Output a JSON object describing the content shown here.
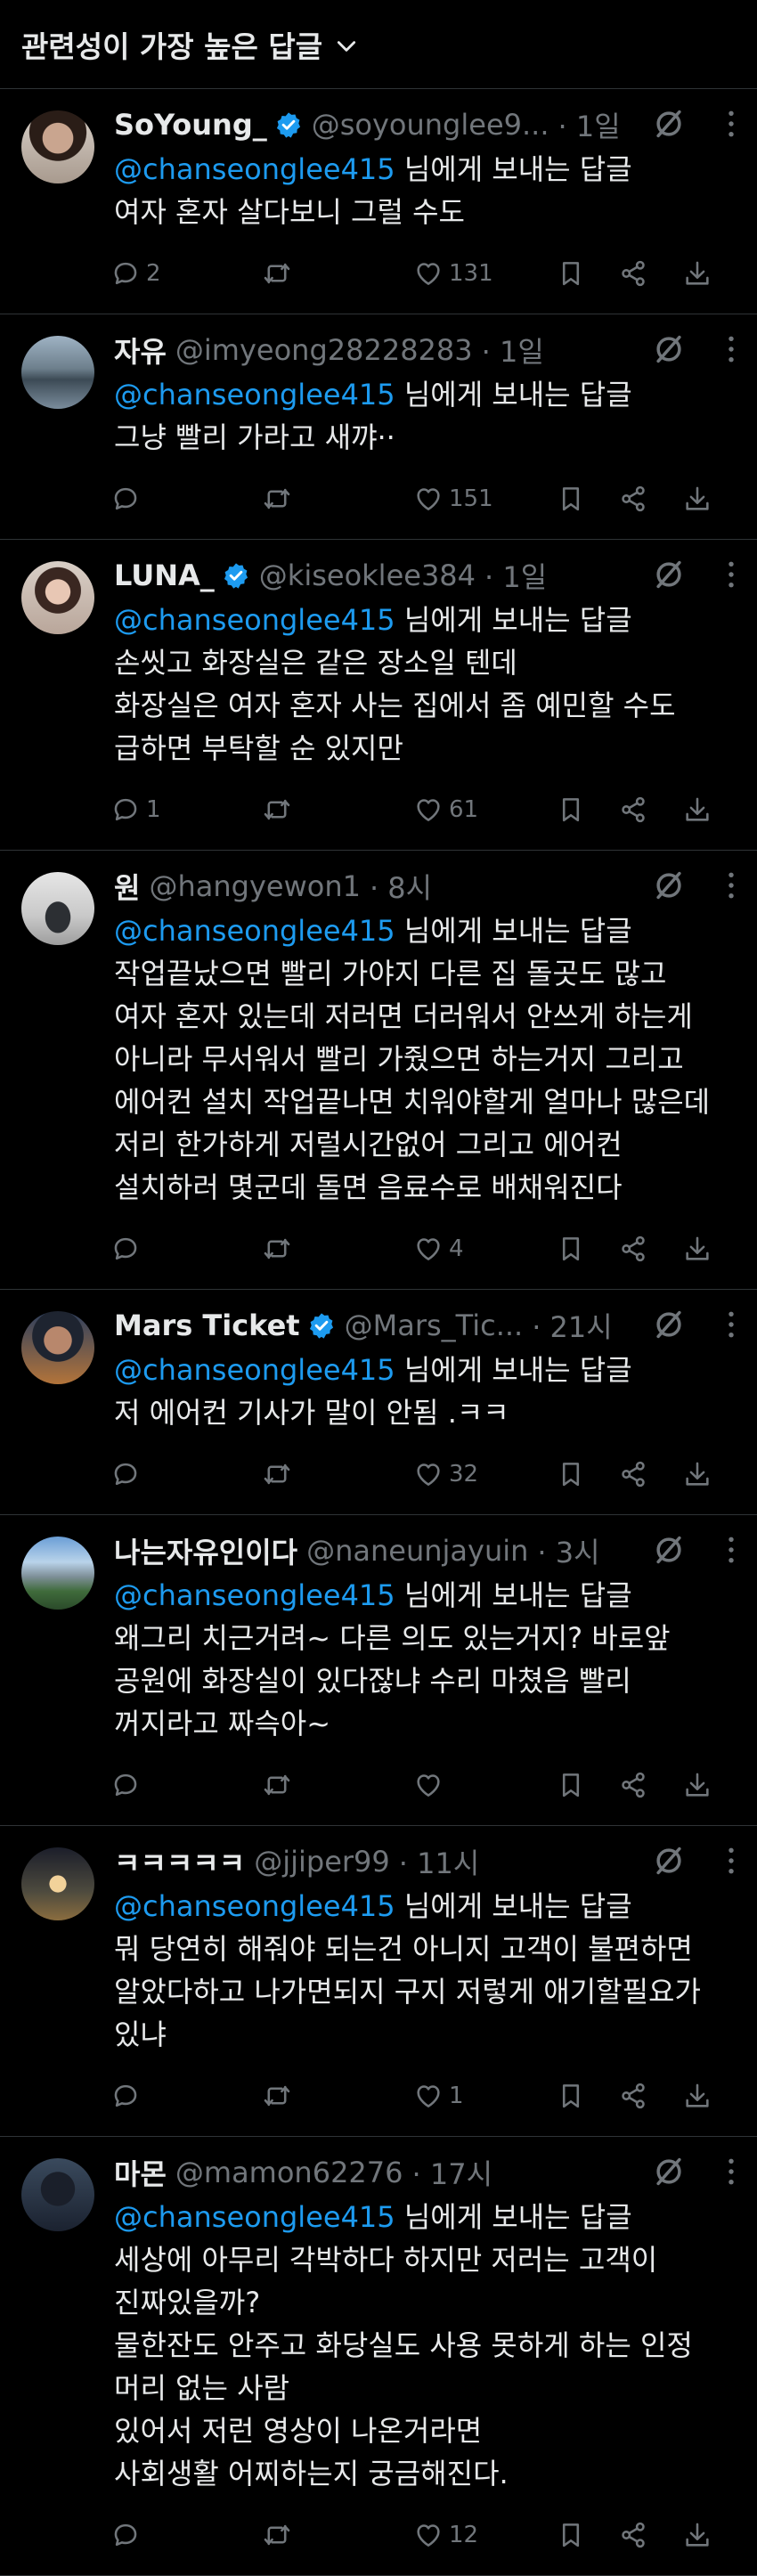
{
  "sort_label": "관련성이 가장 높은 답글",
  "reply_to_suffix": "님에게 보내는 답글",
  "colors": {
    "background": "#000000",
    "mention": "#1d9bf0",
    "muted": "#71767b",
    "verified": "#1d9bf0",
    "divider": "#2f3336"
  },
  "replies": [
    {
      "name": "SoYoung_",
      "verified": true,
      "handle": "@soyounglee9...",
      "time": "· 1일",
      "mention": "@chanseonglee415",
      "text": "여자 혼자 살다보니 그럴 수도",
      "replies_count": "2",
      "retweets_count": "",
      "likes_count": "131"
    },
    {
      "name": "자유",
      "verified": false,
      "handle": "@imyeong28228283",
      "time": "· 1일",
      "mention": "@chanseonglee415",
      "text": "그냥 빨리 가라고 새꺄··",
      "replies_count": "",
      "retweets_count": "",
      "likes_count": "151"
    },
    {
      "name": "LUNA_",
      "verified": true,
      "handle": "@kiseoklee384",
      "time": "· 1일",
      "mention": "@chanseonglee415",
      "text": "손씻고 화장실은 같은 장소일 텐데\n화장실은 여자 혼자 사는 집에서 좀 예민할 수도\n급하면 부탁할 순 있지만",
      "replies_count": "1",
      "retweets_count": "",
      "likes_count": "61"
    },
    {
      "name": "원",
      "verified": false,
      "handle": "@hangyewon1",
      "time": "· 8시",
      "mention": "@chanseonglee415",
      "text": "작업끝났으면 빨리 가야지 다른 집 돌곳도 많고\n여자 혼자 있는데 저러면 더러워서 안쓰게 하는게\n아니라 무서워서 빨리 가줬으면 하는거지 그리고\n에어컨 설치 작업끝나면 치워야할게 얼마나 많은데\n저리 한가하게 저럴시간없어 그리고 에어컨\n설치하러 몇군데 돌면 음료수로 배채워진다",
      "replies_count": "",
      "retweets_count": "",
      "likes_count": "4"
    },
    {
      "name": "Mars Ticket",
      "verified": true,
      "handle": "@Mars_Tic...",
      "time": "· 21시",
      "mention": "@chanseonglee415",
      "text": "저 에어컨 기사가 말이 안됨 .ㅋㅋ",
      "replies_count": "",
      "retweets_count": "",
      "likes_count": "32"
    },
    {
      "name": "나는자유인이다",
      "verified": false,
      "handle": "@naneunjayuin",
      "time": "· 3시",
      "mention": "@chanseonglee415",
      "text": "왜그리 치근거려~ 다른 의도 있는거지? 바로앞\n공원에 화장실이 있다잖냐 수리 마쳤음 빨리\n꺼지라고 짜슥아~",
      "replies_count": "",
      "retweets_count": "",
      "likes_count": ""
    },
    {
      "name": "ㅋㅋㅋㅋㅋ",
      "verified": false,
      "handle": "@jjiper99",
      "time": "· 11시",
      "mention": "@chanseonglee415",
      "text": "뭐 당연히 해줘야 되는건 아니지 고객이 불편하면\n알았다하고 나가면되지 구지 저렇게 애기할필요가\n있냐",
      "replies_count": "",
      "retweets_count": "",
      "likes_count": "1"
    },
    {
      "name": "마몬",
      "verified": false,
      "handle": "@mamon62276",
      "time": "· 17시",
      "mention": "@chanseonglee415",
      "text": "세상에 아무리 각박하다 하지만 저러는 고객이\n진짜있을까?\n물한잔도 안주고 화당실도 사용 못하게 하는 인정\n머리 없는 사람\n있어서 저런 영상이 나온거라면\n사회생활 어찌하는지 궁금해진다.",
      "replies_count": "",
      "retweets_count": "",
      "likes_count": "12"
    }
  ]
}
